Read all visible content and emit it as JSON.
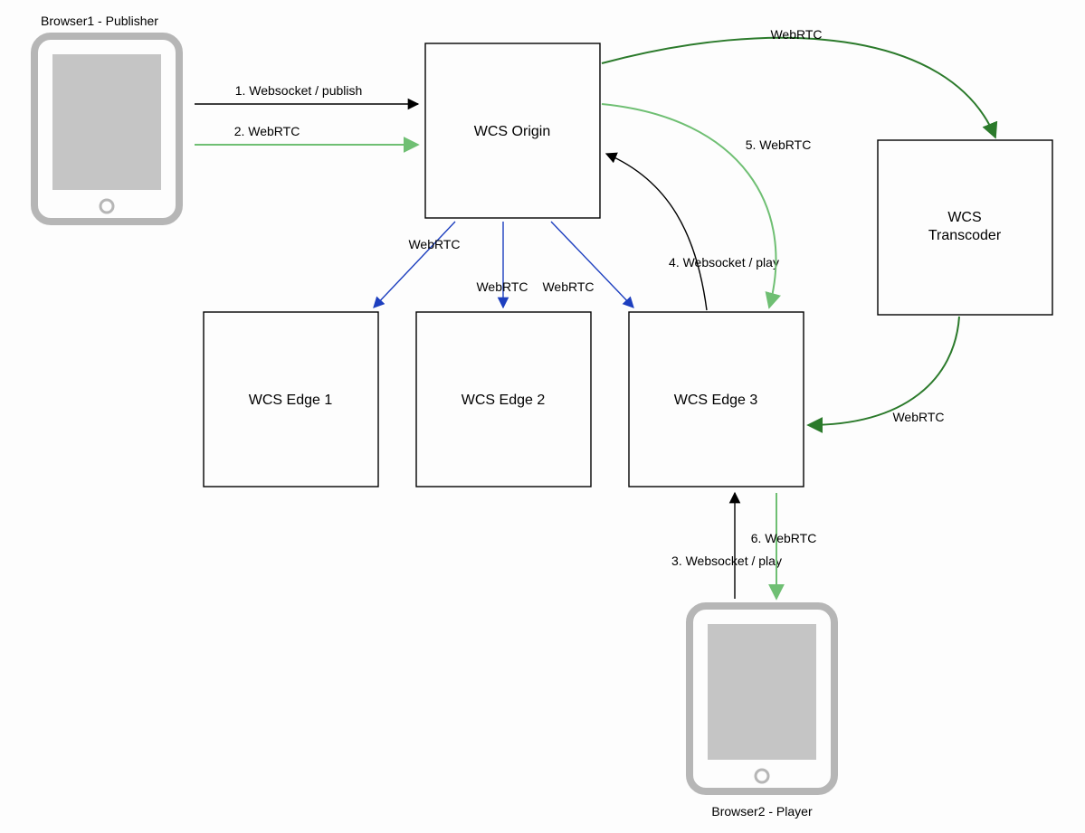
{
  "devices": {
    "browser1": {
      "label": "Browser1 - Publisher"
    },
    "browser2": {
      "label": "Browser2 - Player"
    }
  },
  "nodes": {
    "origin": {
      "label": "WCS Origin"
    },
    "transcoder": {
      "label": "WCS",
      "label2": "Transcoder"
    },
    "edge1": {
      "label": "WCS Edge 1"
    },
    "edge2": {
      "label": "WCS Edge 2"
    },
    "edge3": {
      "label": "WCS Edge 3"
    }
  },
  "edges": {
    "e1": {
      "label": "1. Websocket / publish"
    },
    "e2": {
      "label": "2. WebRTC"
    },
    "e3": {
      "label": "3. Websocket / play"
    },
    "e4": {
      "label": "4. Websocket / play"
    },
    "e5": {
      "label": "5. WebRTC"
    },
    "e6": {
      "label": "6. WebRTC"
    },
    "oT": {
      "label": "WebRTC"
    },
    "tE3": {
      "label": "WebRTC"
    },
    "oE1": {
      "label": "WebRTC"
    },
    "oE2": {
      "label": "WebRTC"
    },
    "oE3": {
      "label": "WebRTC"
    }
  }
}
